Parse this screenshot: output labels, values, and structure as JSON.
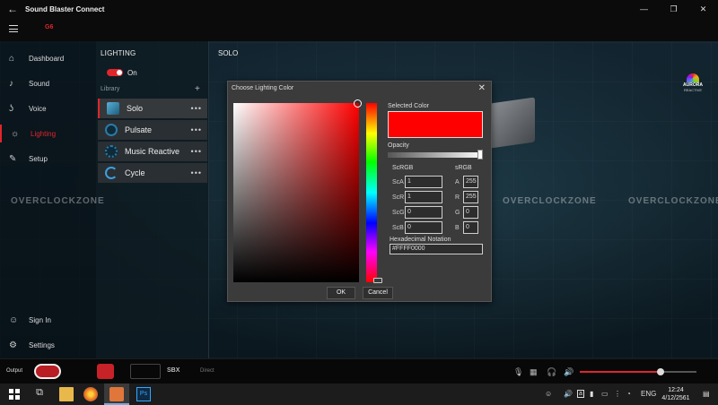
{
  "window": {
    "title": "Sound Blaster Connect",
    "back_icon": "back-arrow-icon",
    "controls": [
      "—",
      "❐",
      "✕"
    ]
  },
  "topnav": {
    "device_tab": "G6"
  },
  "sidebar": {
    "items": [
      {
        "label": "Dashboard",
        "icon": "home-icon"
      },
      {
        "label": "Sound",
        "icon": "music-note-icon"
      },
      {
        "label": "Voice",
        "icon": "voice-icon"
      },
      {
        "label": "Lighting",
        "icon": "lighting-icon",
        "active": true
      },
      {
        "label": "Setup",
        "icon": "wrench-icon"
      }
    ],
    "bottom_items": [
      {
        "label": "Sign In",
        "icon": "user-icon"
      },
      {
        "label": "Settings",
        "icon": "gear-icon"
      }
    ]
  },
  "lighting": {
    "title": "LIGHTING",
    "toggle_label": "On",
    "library_label": "Library",
    "effects": [
      {
        "name": "Solo",
        "active": true
      },
      {
        "name": "Pulsate"
      },
      {
        "name": "Music Reactive"
      },
      {
        "name": "Cycle"
      }
    ],
    "more": "•••"
  },
  "main": {
    "title": "SOLO",
    "badge": {
      "line1": "AURORA",
      "line2": "REACTIVE"
    },
    "watermark": "OVERCLOCKZONE"
  },
  "dialog": {
    "title": "Choose Lighting Color",
    "selected_color_label": "Selected Color",
    "selected_color": "#FF0000",
    "opacity_label": "Opacity",
    "opacity": 1,
    "scrgb_header": "ScRGB",
    "srgb_header": "sRGB",
    "scrgb": {
      "ScA": "1",
      "ScR": "1",
      "ScG": "0",
      "ScB": "0"
    },
    "srgb": {
      "A": "255",
      "R": "255",
      "G": "0",
      "B": "0"
    },
    "hex_label": "Hexadecimal Notation",
    "hex_value": "#FFFF0000",
    "ok": "OK",
    "cancel": "Cancel"
  },
  "bottombar": {
    "output_label": "Output",
    "sbx_label": "SBX",
    "direct_label": "Direct",
    "volume": 0.69
  },
  "taskbar": {
    "lang": "ENG",
    "time": "12:24",
    "date": "4/12/2561"
  }
}
